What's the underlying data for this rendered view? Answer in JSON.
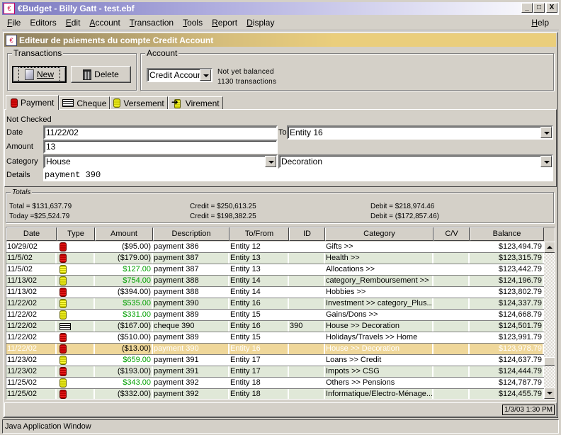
{
  "window": {
    "title": "€Budget - Billy Gatt - test.ebf",
    "controls": [
      "_",
      "□",
      "X"
    ]
  },
  "menu": {
    "items": [
      {
        "label": "File",
        "mnemonic": "F"
      },
      {
        "label": "Editors",
        "mnemonic": ""
      },
      {
        "label": "Edit",
        "mnemonic": "E"
      },
      {
        "label": "Account",
        "mnemonic": "A"
      },
      {
        "label": "Transaction",
        "mnemonic": "T"
      },
      {
        "label": "Tools",
        "mnemonic": "T"
      },
      {
        "label": "Report",
        "mnemonic": "R"
      },
      {
        "label": "Display",
        "mnemonic": "D"
      }
    ],
    "help": "Help"
  },
  "editor": {
    "title": "Editeur de paiements du compte  Credit Account"
  },
  "transactions_group": {
    "label": "Transactions",
    "new_label": "New",
    "delete_label": "Delete"
  },
  "account_group": {
    "label": "Account",
    "selected": "Credit Account",
    "status": "Not yet balanced",
    "count": "1130 transactions"
  },
  "tabs": [
    {
      "label": "Payment",
      "icon": "payment-icon",
      "active": true
    },
    {
      "label": "Cheque",
      "icon": "cheque-icon",
      "active": false
    },
    {
      "label": "Versement",
      "icon": "versement-icon",
      "active": false
    },
    {
      "label": "Virement",
      "icon": "virement-icon",
      "active": false
    }
  ],
  "form": {
    "check_status": "Not Checked",
    "date_label": "Date",
    "date_value": "11/22/02",
    "to_label": "To",
    "to_value": "Entity 16",
    "amount_label": "Amount",
    "amount_value": "13",
    "category_label": "Category",
    "category_value": "House",
    "subcategory_value": "Decoration",
    "details_label": "Details",
    "details_value": "payment 390"
  },
  "totals": {
    "label": "Totals",
    "total": "Total = $131,637.79",
    "today": "Today =$25,524.79",
    "credit_total": "Credit = $250,613.25",
    "credit_today": "Credit = $198,382.25",
    "debit_total": "Debit = $218,974.46",
    "debit_today": "Debit = ($172,857.46)"
  },
  "table": {
    "columns": [
      "Date",
      "Type",
      "Amount",
      "Description",
      "To/From",
      "ID",
      "Category",
      "C/V",
      "Balance"
    ],
    "rows": [
      {
        "date": "10/29/02",
        "type": "payment",
        "amount": "($95.00)",
        "credit": false,
        "description": "payment 386",
        "tofrom": "Entity 12",
        "id": "",
        "category": "Gifts >>",
        "cv": "",
        "balance": "$123,494.79"
      },
      {
        "date": "11/5/02",
        "type": "payment",
        "amount": "($179.00)",
        "credit": false,
        "description": "payment 387",
        "tofrom": "Entity 13",
        "id": "",
        "category": "Health >>",
        "cv": "",
        "balance": "$123,315.79"
      },
      {
        "date": "11/5/02",
        "type": "versement",
        "amount": "$127.00",
        "credit": true,
        "description": "payment 387",
        "tofrom": "Entity 13",
        "id": "",
        "category": "Allocations >>",
        "cv": "",
        "balance": "$123,442.79"
      },
      {
        "date": "11/13/02",
        "type": "versement",
        "amount": "$754.00",
        "credit": true,
        "description": "payment 388",
        "tofrom": "Entity 14",
        "id": "",
        "category": "category_Remboursement >>",
        "cv": "",
        "balance": "$124,196.79"
      },
      {
        "date": "11/13/02",
        "type": "payment",
        "amount": "($394.00)",
        "credit": false,
        "description": "payment 388",
        "tofrom": "Entity 14",
        "id": "",
        "category": "Hobbies >>",
        "cv": "",
        "balance": "$123,802.79"
      },
      {
        "date": "11/22/02",
        "type": "versement",
        "amount": "$535.00",
        "credit": true,
        "description": "payment 390",
        "tofrom": "Entity 16",
        "id": "",
        "category": "Investment >> category_Plus...",
        "cv": "",
        "balance": "$124,337.79"
      },
      {
        "date": "11/22/02",
        "type": "versement",
        "amount": "$331.00",
        "credit": true,
        "description": "payment 389",
        "tofrom": "Entity 15",
        "id": "",
        "category": "Gains/Dons >>",
        "cv": "",
        "balance": "$124,668.79"
      },
      {
        "date": "11/22/02",
        "type": "cheque",
        "amount": "($167.00)",
        "credit": false,
        "description": "cheque 390",
        "tofrom": "Entity 16",
        "id": "390",
        "category": "House >> Decoration",
        "cv": "",
        "balance": "$124,501.79"
      },
      {
        "date": "11/22/02",
        "type": "payment",
        "amount": "($510.00)",
        "credit": false,
        "description": "payment 389",
        "tofrom": "Entity 15",
        "id": "",
        "category": "Holidays/Travels >> Home",
        "cv": "",
        "balance": "$123,991.79"
      },
      {
        "date": "11/22/02",
        "type": "payment",
        "amount": "($13.00)",
        "credit": false,
        "description": "payment 390",
        "tofrom": "Entity 16",
        "id": "",
        "category": "House >> Decoration",
        "cv": "",
        "balance": "$123,978.79",
        "selected": true
      },
      {
        "date": "11/23/02",
        "type": "versement",
        "amount": "$659.00",
        "credit": true,
        "description": "payment 391",
        "tofrom": "Entity 17",
        "id": "",
        "category": "Loans >> Credit",
        "cv": "",
        "balance": "$124,637.79"
      },
      {
        "date": "11/23/02",
        "type": "payment",
        "amount": "($193.00)",
        "credit": false,
        "description": "payment 391",
        "tofrom": "Entity 17",
        "id": "",
        "category": "Impots >> CSG",
        "cv": "",
        "balance": "$124,444.79"
      },
      {
        "date": "11/25/02",
        "type": "versement",
        "amount": "$343.00",
        "credit": true,
        "description": "payment 392",
        "tofrom": "Entity 18",
        "id": "",
        "category": "Others >> Pensions",
        "cv": "",
        "balance": "$124,787.79"
      },
      {
        "date": "11/25/02",
        "type": "payment",
        "amount": "($332.00)",
        "credit": false,
        "description": "payment 392",
        "tofrom": "Entity 18",
        "id": "",
        "category": "Informatique/Electro-Ménage...",
        "cv": "",
        "balance": "$124,455.79"
      }
    ]
  },
  "status": {
    "datetime": "1/3/03 1:30 PM"
  },
  "taskbar": {
    "label": "Java Application Window"
  },
  "colors": {
    "credit_green": "#00a000",
    "selected_row": "#efd79a",
    "alt_row": "#e0e8d8"
  }
}
